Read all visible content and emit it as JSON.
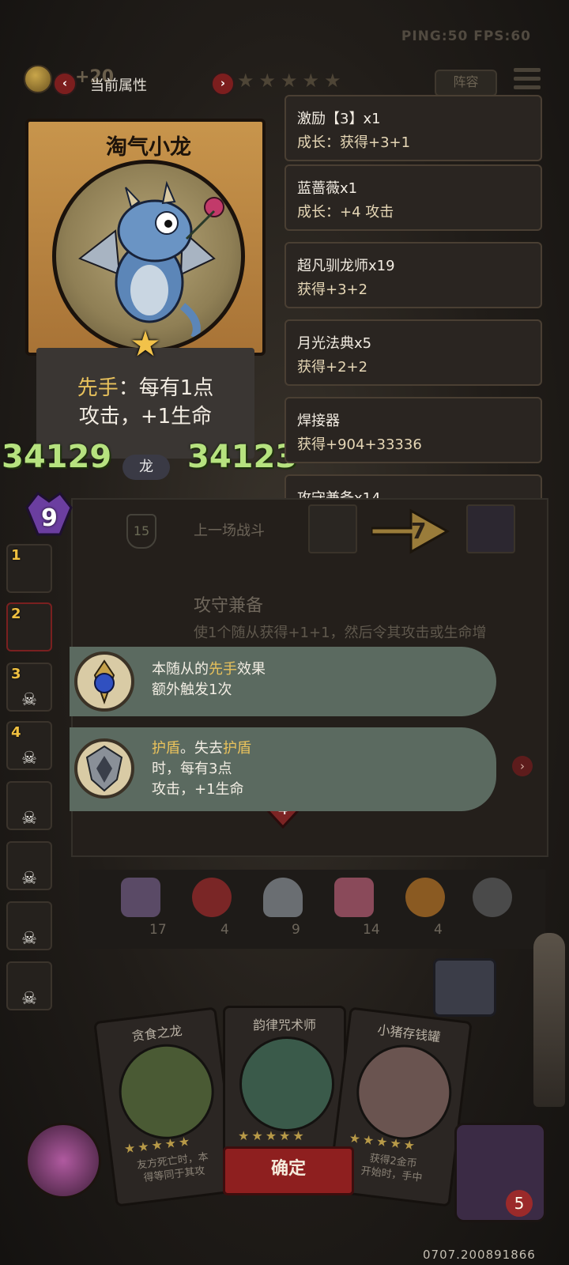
{
  "hud": {
    "ping_fps": "PING:50   FPS:60",
    "gold_plus": "+20",
    "lineup_label": "阵容"
  },
  "attributes_panel": {
    "title": "当前属性"
  },
  "minion_card": {
    "name": "淘气小龙",
    "ability_keyword": "先手",
    "ability_line1_rest": "：每有1点",
    "ability_line2": "攻击，+1生命",
    "attack": "34129",
    "health": "34123",
    "tribe": "龙"
  },
  "buffs": [
    {
      "name": "激励【3】x1",
      "desc": "成长：获得+3+1"
    },
    {
      "name": "蓝蔷薇x1",
      "desc": "成长：+4 攻击"
    },
    {
      "name": "超凡驯龙师x19",
      "desc": "获得+3+2"
    },
    {
      "name": "月光法典x5",
      "desc": "获得+2+2"
    },
    {
      "name": "焊接器",
      "desc": "获得+904+33336"
    },
    {
      "name": "攻守兼备x14",
      "desc": ""
    }
  ],
  "lower_panel": {
    "wave": "9",
    "shield_value": "15",
    "last_battle_label": "上一场战斗",
    "damage": "7",
    "dim_title": "攻守兼备",
    "dim_desc": "使1个随从获得+1+1，然后令其攻击或生命增"
  },
  "tooltips": [
    {
      "line1_plain": "本随从的",
      "line1_kw": "先手",
      "line1_tail": "效果",
      "line2": "额外触发1次"
    },
    {
      "line1_kw": "护盾",
      "line1_mid": "。失去",
      "line1_kw2": "护盾",
      "line2": "时，每有3点",
      "line3": "攻击，+1生命"
    }
  ],
  "warband_slots": [
    "1",
    "2",
    "3",
    "4",
    "",
    "",
    "",
    ""
  ],
  "resources": [
    {
      "icon": "shield-card-icon",
      "count": "17"
    },
    {
      "icon": "alarm-clock-icon",
      "count": "4"
    },
    {
      "icon": "teacup-icon",
      "count": "9"
    },
    {
      "icon": "cupcake-icon",
      "count": "14"
    },
    {
      "icon": "pufferfish-icon",
      "count": "4"
    },
    {
      "icon": "bomb-creature-icon",
      "count": ""
    }
  ],
  "shop": [
    {
      "name": "贪食之龙",
      "desc_line1": "友方死亡时，本",
      "desc_line2": "得等同于其攻"
    },
    {
      "name": "韵律咒术师",
      "desc_line1": "",
      "desc_line2": ""
    },
    {
      "name": "小猪存钱罐",
      "desc_line1": "获得2金币",
      "desc_line2": "开始时，手中"
    }
  ],
  "confirm_label": "确定",
  "hero_life": "5",
  "build_id": "0707.200891866",
  "colors": {
    "keyword": "#e9c25c",
    "stat_green": "#b6e27f",
    "confirm_red": "#8e1f1f",
    "tooltip_bg": "#5b6a60"
  }
}
